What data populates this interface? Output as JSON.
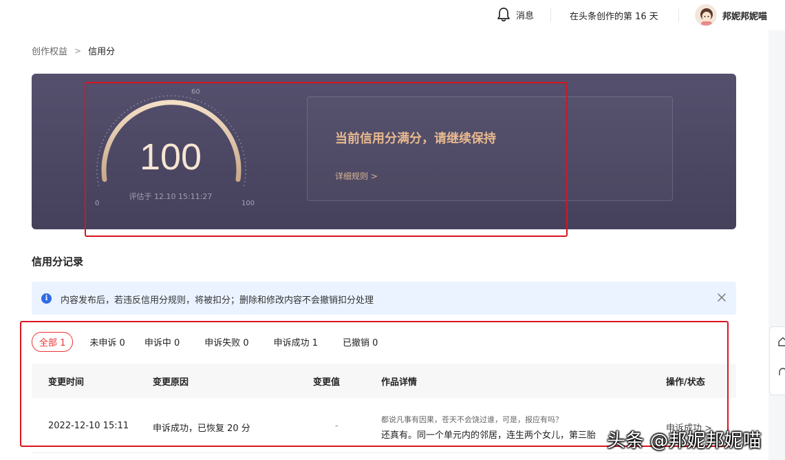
{
  "topbar": {
    "messages_label": "消息",
    "days_text": "在头条创作的第 16 天",
    "username": "邦妮邦妮喵"
  },
  "breadcrumb": {
    "parent": "创作权益",
    "separator": ">",
    "current": "信用分"
  },
  "banner": {
    "score": "100",
    "evaluated_at": "评估于 12.10 15:11:27",
    "gauge_min": "0",
    "gauge_mid": "60",
    "gauge_max": "100",
    "score_fraction": 1.0,
    "message": "当前信用分满分，请继续保持",
    "rules_link": "详细规则 >"
  },
  "records": {
    "title": "信用分记录",
    "notice": "内容发布后，若违反信用分规则，将被扣分；删除和修改内容不会撤销扣分处理",
    "tabs": [
      {
        "label": "全部 1",
        "active": true
      },
      {
        "label": "未申诉 0"
      },
      {
        "label": "申诉中 0"
      },
      {
        "label": "申诉失败 0"
      },
      {
        "label": "申诉成功 1"
      },
      {
        "label": "已撤销 0"
      }
    ],
    "columns": {
      "time": "变更时间",
      "reason": "变更原因",
      "value": "变更值",
      "detail": "作品详情",
      "action": "操作/状态"
    },
    "rows": [
      {
        "time": "2022-12-10 15:11",
        "reason": "申诉成功，已恢复 20 分",
        "value": "-",
        "detail_title": "都说凡事有因果，苍天不会饶过谁，可是，报应有吗？",
        "detail_body": "还真有。同一个单元内的邻居，连生两个女儿，第三胎",
        "status": "申诉成功 >"
      }
    ]
  },
  "watermark": "头条 @邦妮邦妮喵",
  "colors": {
    "accent_red": "#e33333",
    "annotation_red": "#d9141e",
    "banner_bg": "#4c4864",
    "gold_text": "#e8b98f",
    "notice_bg": "#eaf3ff",
    "info_blue": "#2f6be6"
  }
}
